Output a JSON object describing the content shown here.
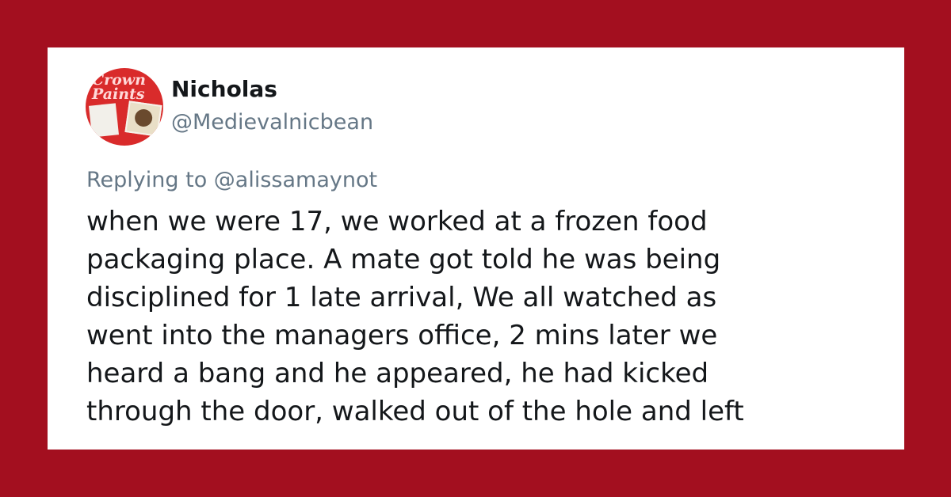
{
  "colors": {
    "background": "#a30f1f",
    "card": "#ffffff",
    "text_primary": "#14171a",
    "text_secondary": "#657786"
  },
  "tweet": {
    "author": {
      "display_name": "Nicholas",
      "handle": "@Medievalnicbean",
      "avatar_logo_text": "Crown Paints"
    },
    "reply_context": "Replying to @alissamaynot",
    "body_lines": [
      "when we were 17, we worked at a frozen food",
      "packaging place. A mate got told he was being",
      "disciplined for 1 late arrival, We all watched as",
      "went into the managers office, 2 mins later we",
      "heard a bang and he appeared, he had kicked",
      "through the door, walked out of the hole and left"
    ]
  }
}
